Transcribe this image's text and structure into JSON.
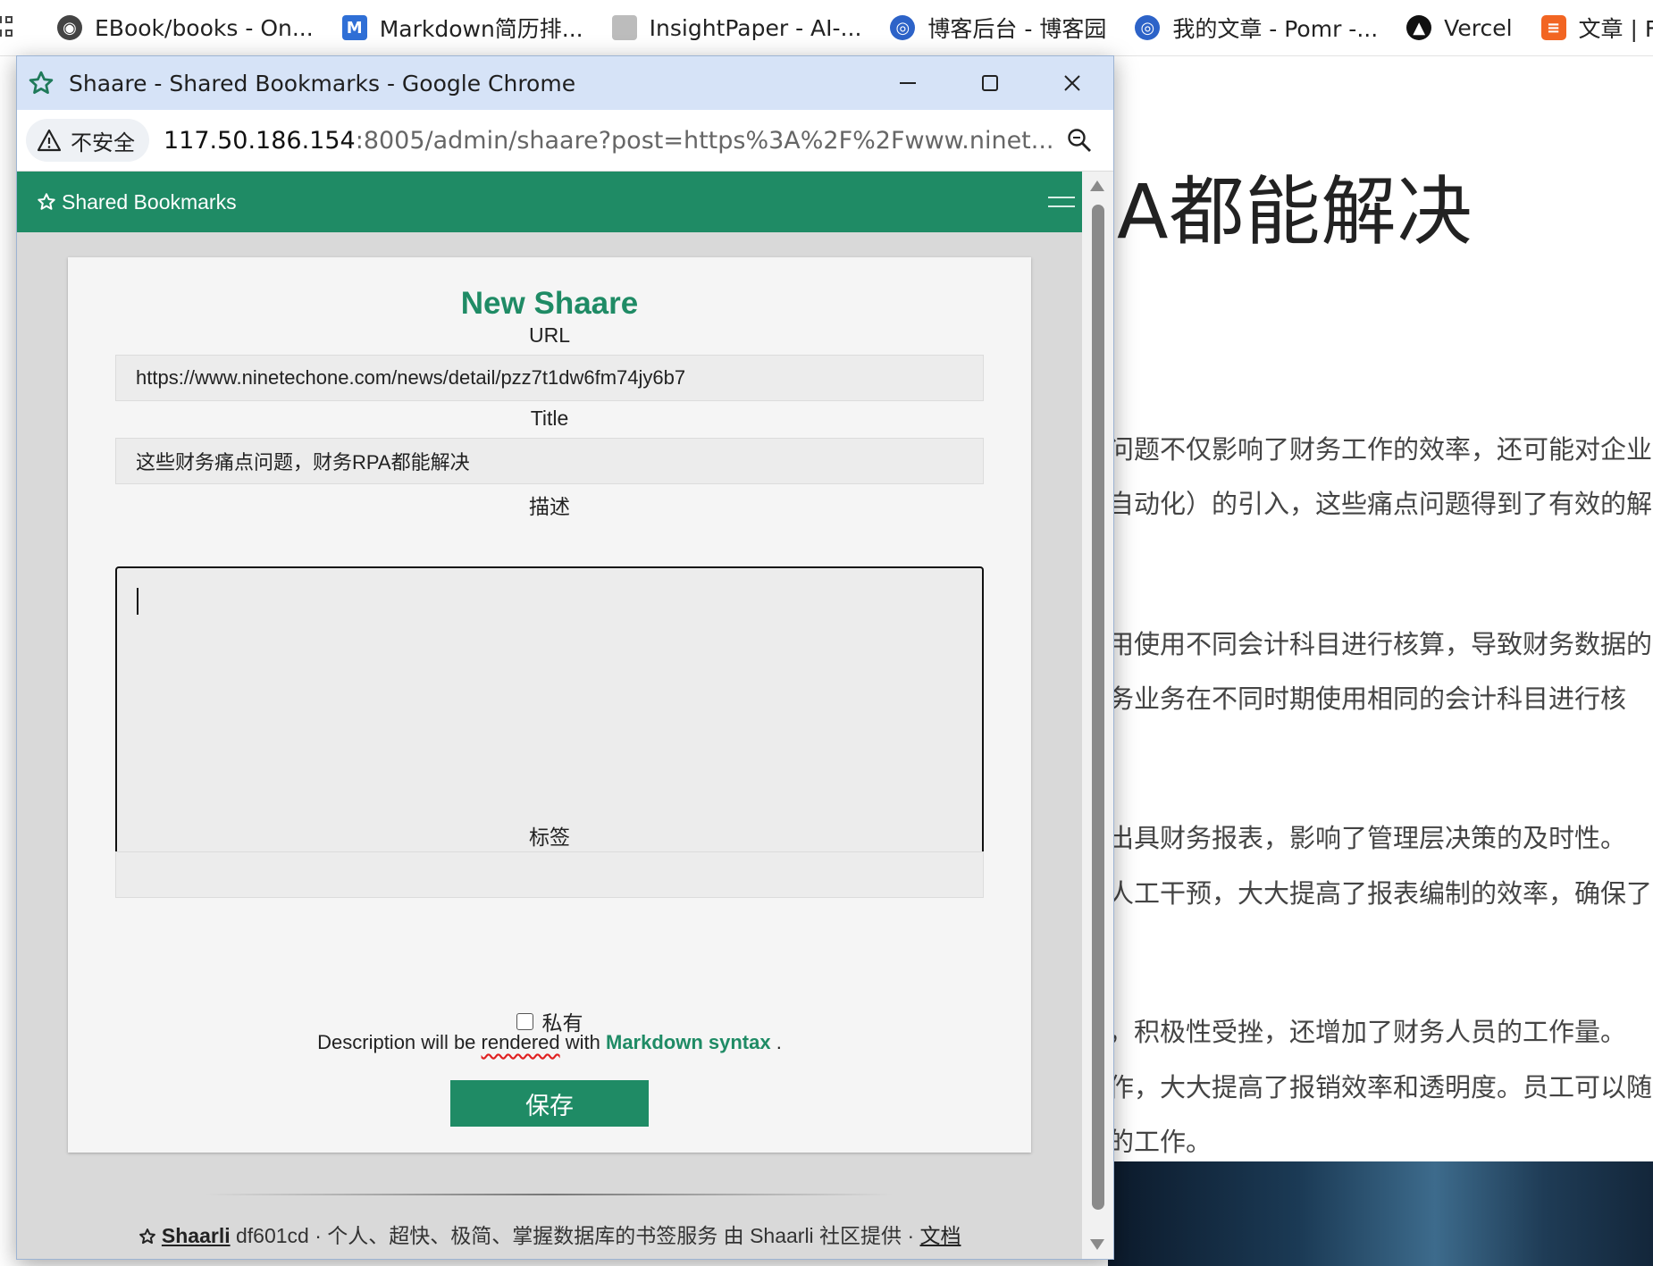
{
  "bookmarks_bar": {
    "items": [
      {
        "label": "EBook/books - On...",
        "icon": "globe-icon"
      },
      {
        "label": "Markdown简历排...",
        "icon": "markdown-icon"
      },
      {
        "label": "InsightPaper - AI-...",
        "icon": "paper-icon"
      },
      {
        "label": "博客后台 - 博客园",
        "icon": "cnblogs-icon"
      },
      {
        "label": "我的文章 - Pomr -...",
        "icon": "cnblogs-icon"
      },
      {
        "label": "Vercel",
        "icon": "vercel-icon"
      },
      {
        "label": "文章 | F",
        "icon": "article-icon"
      }
    ]
  },
  "background_page": {
    "heading": "A都能解决",
    "lines": [
      "问题不仅影响了财务工作的效率，还可能对企业",
      "自动化）的引入，这些痛点问题得到了有效的解",
      "用使用不同会计科目进行核算，导致财务数据的",
      "务业务在不同时期使用相同的会计科目进行核",
      "出具财务报表，影响了管理层决策的及时性。",
      "人工干预，大大提高了报表编制的效率，确保了",
      "，积极性受挫，还增加了财务人员的工作量。",
      "作，大大提高了报销效率和透明度。员工可以随",
      "的工作。"
    ]
  },
  "window": {
    "title": "Shaare - Shared Bookmarks - Google Chrome",
    "security_label": "不安全",
    "url_host": "117.50.186.154",
    "url_rest": ":8005/admin/shaare?post=https%3A%2F%2Fwww.ninet..."
  },
  "navbar": {
    "brand": "Shared Bookmarks"
  },
  "form": {
    "heading": "New Shaare",
    "url_label": "URL",
    "url_value": "https://www.ninetechone.com/news/detail/pzz7t1dw6fm74jy6b7",
    "title_label": "Title",
    "title_value": "这些财务痛点问题，财务RPA都能解决",
    "description_label": "描述",
    "description_value": "",
    "tags_label": "标签",
    "tags_value": "",
    "private_label": "私有",
    "private_checked": false,
    "markdown_note_prefix": "Description will be",
    "markdown_note_word": "rendered",
    "markdown_note_with": "with",
    "markdown_link": "Markdown syntax",
    "markdown_note_suffix": ".",
    "save_label": "保存"
  },
  "footer": {
    "app_name": "Shaarli",
    "text": "df601cd · 个人、超快、极简、掌握数据库的书签服务 由 Shaarli 社区提供 ·",
    "docs_link": "文档"
  },
  "colors": {
    "accent": "#1f8b65",
    "titlebar": "#d6e3f7"
  }
}
